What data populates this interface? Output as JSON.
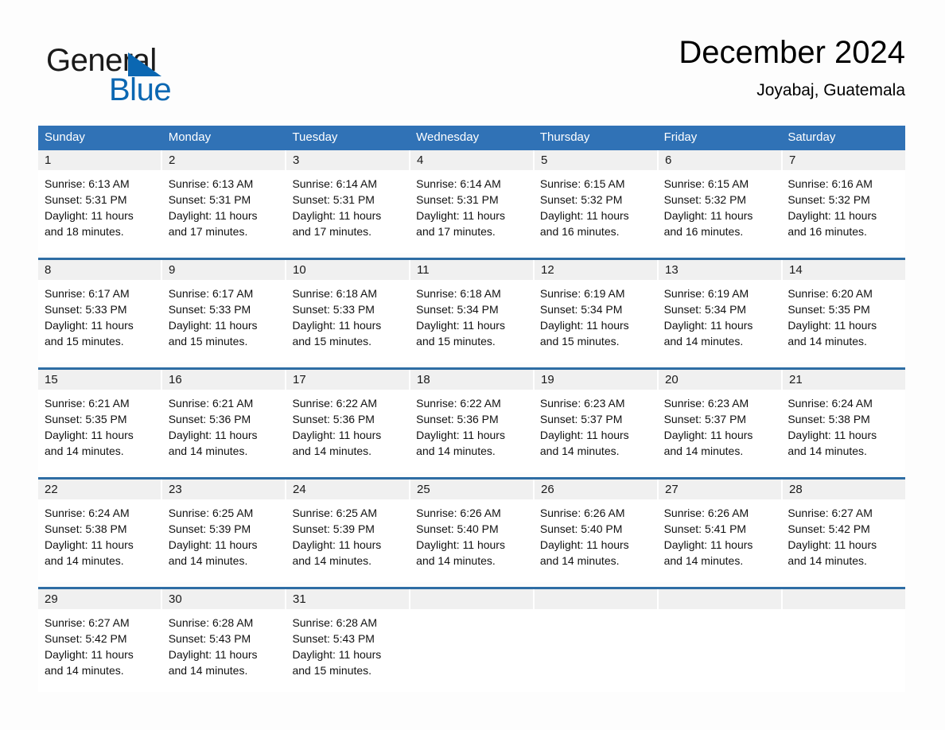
{
  "brand": {
    "name_part1": "General",
    "name_part2": "Blue",
    "logo_icon": "triangle-logo-icon",
    "accent_color": "#0b67b2"
  },
  "header": {
    "title": "December 2024",
    "subtitle": "Joyabaj, Guatemala"
  },
  "theme": {
    "header_blue": "#3072b6",
    "row_divider_blue": "#2e6da4",
    "daynum_band": "#f0f0f0"
  },
  "weekdays": [
    {
      "label": "Sunday"
    },
    {
      "label": "Monday"
    },
    {
      "label": "Tuesday"
    },
    {
      "label": "Wednesday"
    },
    {
      "label": "Thursday"
    },
    {
      "label": "Friday"
    },
    {
      "label": "Saturday"
    }
  ],
  "weeks": [
    {
      "days": [
        {
          "num": "1",
          "line1": "Sunrise: 6:13 AM",
          "line2": "Sunset: 5:31 PM",
          "line3": "Daylight: 11 hours",
          "line4": "and 18 minutes."
        },
        {
          "num": "2",
          "line1": "Sunrise: 6:13 AM",
          "line2": "Sunset: 5:31 PM",
          "line3": "Daylight: 11 hours",
          "line4": "and 17 minutes."
        },
        {
          "num": "3",
          "line1": "Sunrise: 6:14 AM",
          "line2": "Sunset: 5:31 PM",
          "line3": "Daylight: 11 hours",
          "line4": "and 17 minutes."
        },
        {
          "num": "4",
          "line1": "Sunrise: 6:14 AM",
          "line2": "Sunset: 5:31 PM",
          "line3": "Daylight: 11 hours",
          "line4": "and 17 minutes."
        },
        {
          "num": "5",
          "line1": "Sunrise: 6:15 AM",
          "line2": "Sunset: 5:32 PM",
          "line3": "Daylight: 11 hours",
          "line4": "and 16 minutes."
        },
        {
          "num": "6",
          "line1": "Sunrise: 6:15 AM",
          "line2": "Sunset: 5:32 PM",
          "line3": "Daylight: 11 hours",
          "line4": "and 16 minutes."
        },
        {
          "num": "7",
          "line1": "Sunrise: 6:16 AM",
          "line2": "Sunset: 5:32 PM",
          "line3": "Daylight: 11 hours",
          "line4": "and 16 minutes."
        }
      ]
    },
    {
      "days": [
        {
          "num": "8",
          "line1": "Sunrise: 6:17 AM",
          "line2": "Sunset: 5:33 PM",
          "line3": "Daylight: 11 hours",
          "line4": "and 15 minutes."
        },
        {
          "num": "9",
          "line1": "Sunrise: 6:17 AM",
          "line2": "Sunset: 5:33 PM",
          "line3": "Daylight: 11 hours",
          "line4": "and 15 minutes."
        },
        {
          "num": "10",
          "line1": "Sunrise: 6:18 AM",
          "line2": "Sunset: 5:33 PM",
          "line3": "Daylight: 11 hours",
          "line4": "and 15 minutes."
        },
        {
          "num": "11",
          "line1": "Sunrise: 6:18 AM",
          "line2": "Sunset: 5:34 PM",
          "line3": "Daylight: 11 hours",
          "line4": "and 15 minutes."
        },
        {
          "num": "12",
          "line1": "Sunrise: 6:19 AM",
          "line2": "Sunset: 5:34 PM",
          "line3": "Daylight: 11 hours",
          "line4": "and 15 minutes."
        },
        {
          "num": "13",
          "line1": "Sunrise: 6:19 AM",
          "line2": "Sunset: 5:34 PM",
          "line3": "Daylight: 11 hours",
          "line4": "and 14 minutes."
        },
        {
          "num": "14",
          "line1": "Sunrise: 6:20 AM",
          "line2": "Sunset: 5:35 PM",
          "line3": "Daylight: 11 hours",
          "line4": "and 14 minutes."
        }
      ]
    },
    {
      "days": [
        {
          "num": "15",
          "line1": "Sunrise: 6:21 AM",
          "line2": "Sunset: 5:35 PM",
          "line3": "Daylight: 11 hours",
          "line4": "and 14 minutes."
        },
        {
          "num": "16",
          "line1": "Sunrise: 6:21 AM",
          "line2": "Sunset: 5:36 PM",
          "line3": "Daylight: 11 hours",
          "line4": "and 14 minutes."
        },
        {
          "num": "17",
          "line1": "Sunrise: 6:22 AM",
          "line2": "Sunset: 5:36 PM",
          "line3": "Daylight: 11 hours",
          "line4": "and 14 minutes."
        },
        {
          "num": "18",
          "line1": "Sunrise: 6:22 AM",
          "line2": "Sunset: 5:36 PM",
          "line3": "Daylight: 11 hours",
          "line4": "and 14 minutes."
        },
        {
          "num": "19",
          "line1": "Sunrise: 6:23 AM",
          "line2": "Sunset: 5:37 PM",
          "line3": "Daylight: 11 hours",
          "line4": "and 14 minutes."
        },
        {
          "num": "20",
          "line1": "Sunrise: 6:23 AM",
          "line2": "Sunset: 5:37 PM",
          "line3": "Daylight: 11 hours",
          "line4": "and 14 minutes."
        },
        {
          "num": "21",
          "line1": "Sunrise: 6:24 AM",
          "line2": "Sunset: 5:38 PM",
          "line3": "Daylight: 11 hours",
          "line4": "and 14 minutes."
        }
      ]
    },
    {
      "days": [
        {
          "num": "22",
          "line1": "Sunrise: 6:24 AM",
          "line2": "Sunset: 5:38 PM",
          "line3": "Daylight: 11 hours",
          "line4": "and 14 minutes."
        },
        {
          "num": "23",
          "line1": "Sunrise: 6:25 AM",
          "line2": "Sunset: 5:39 PM",
          "line3": "Daylight: 11 hours",
          "line4": "and 14 minutes."
        },
        {
          "num": "24",
          "line1": "Sunrise: 6:25 AM",
          "line2": "Sunset: 5:39 PM",
          "line3": "Daylight: 11 hours",
          "line4": "and 14 minutes."
        },
        {
          "num": "25",
          "line1": "Sunrise: 6:26 AM",
          "line2": "Sunset: 5:40 PM",
          "line3": "Daylight: 11 hours",
          "line4": "and 14 minutes."
        },
        {
          "num": "26",
          "line1": "Sunrise: 6:26 AM",
          "line2": "Sunset: 5:40 PM",
          "line3": "Daylight: 11 hours",
          "line4": "and 14 minutes."
        },
        {
          "num": "27",
          "line1": "Sunrise: 6:26 AM",
          "line2": "Sunset: 5:41 PM",
          "line3": "Daylight: 11 hours",
          "line4": "and 14 minutes."
        },
        {
          "num": "28",
          "line1": "Sunrise: 6:27 AM",
          "line2": "Sunset: 5:42 PM",
          "line3": "Daylight: 11 hours",
          "line4": "and 14 minutes."
        }
      ]
    },
    {
      "days": [
        {
          "num": "29",
          "line1": "Sunrise: 6:27 AM",
          "line2": "Sunset: 5:42 PM",
          "line3": "Daylight: 11 hours",
          "line4": "and 14 minutes."
        },
        {
          "num": "30",
          "line1": "Sunrise: 6:28 AM",
          "line2": "Sunset: 5:43 PM",
          "line3": "Daylight: 11 hours",
          "line4": "and 14 minutes."
        },
        {
          "num": "31",
          "line1": "Sunrise: 6:28 AM",
          "line2": "Sunset: 5:43 PM",
          "line3": "Daylight: 11 hours",
          "line4": "and 15 minutes."
        },
        {
          "num": "",
          "line1": "",
          "line2": "",
          "line3": "",
          "line4": ""
        },
        {
          "num": "",
          "line1": "",
          "line2": "",
          "line3": "",
          "line4": ""
        },
        {
          "num": "",
          "line1": "",
          "line2": "",
          "line3": "",
          "line4": ""
        },
        {
          "num": "",
          "line1": "",
          "line2": "",
          "line3": "",
          "line4": ""
        }
      ]
    }
  ]
}
